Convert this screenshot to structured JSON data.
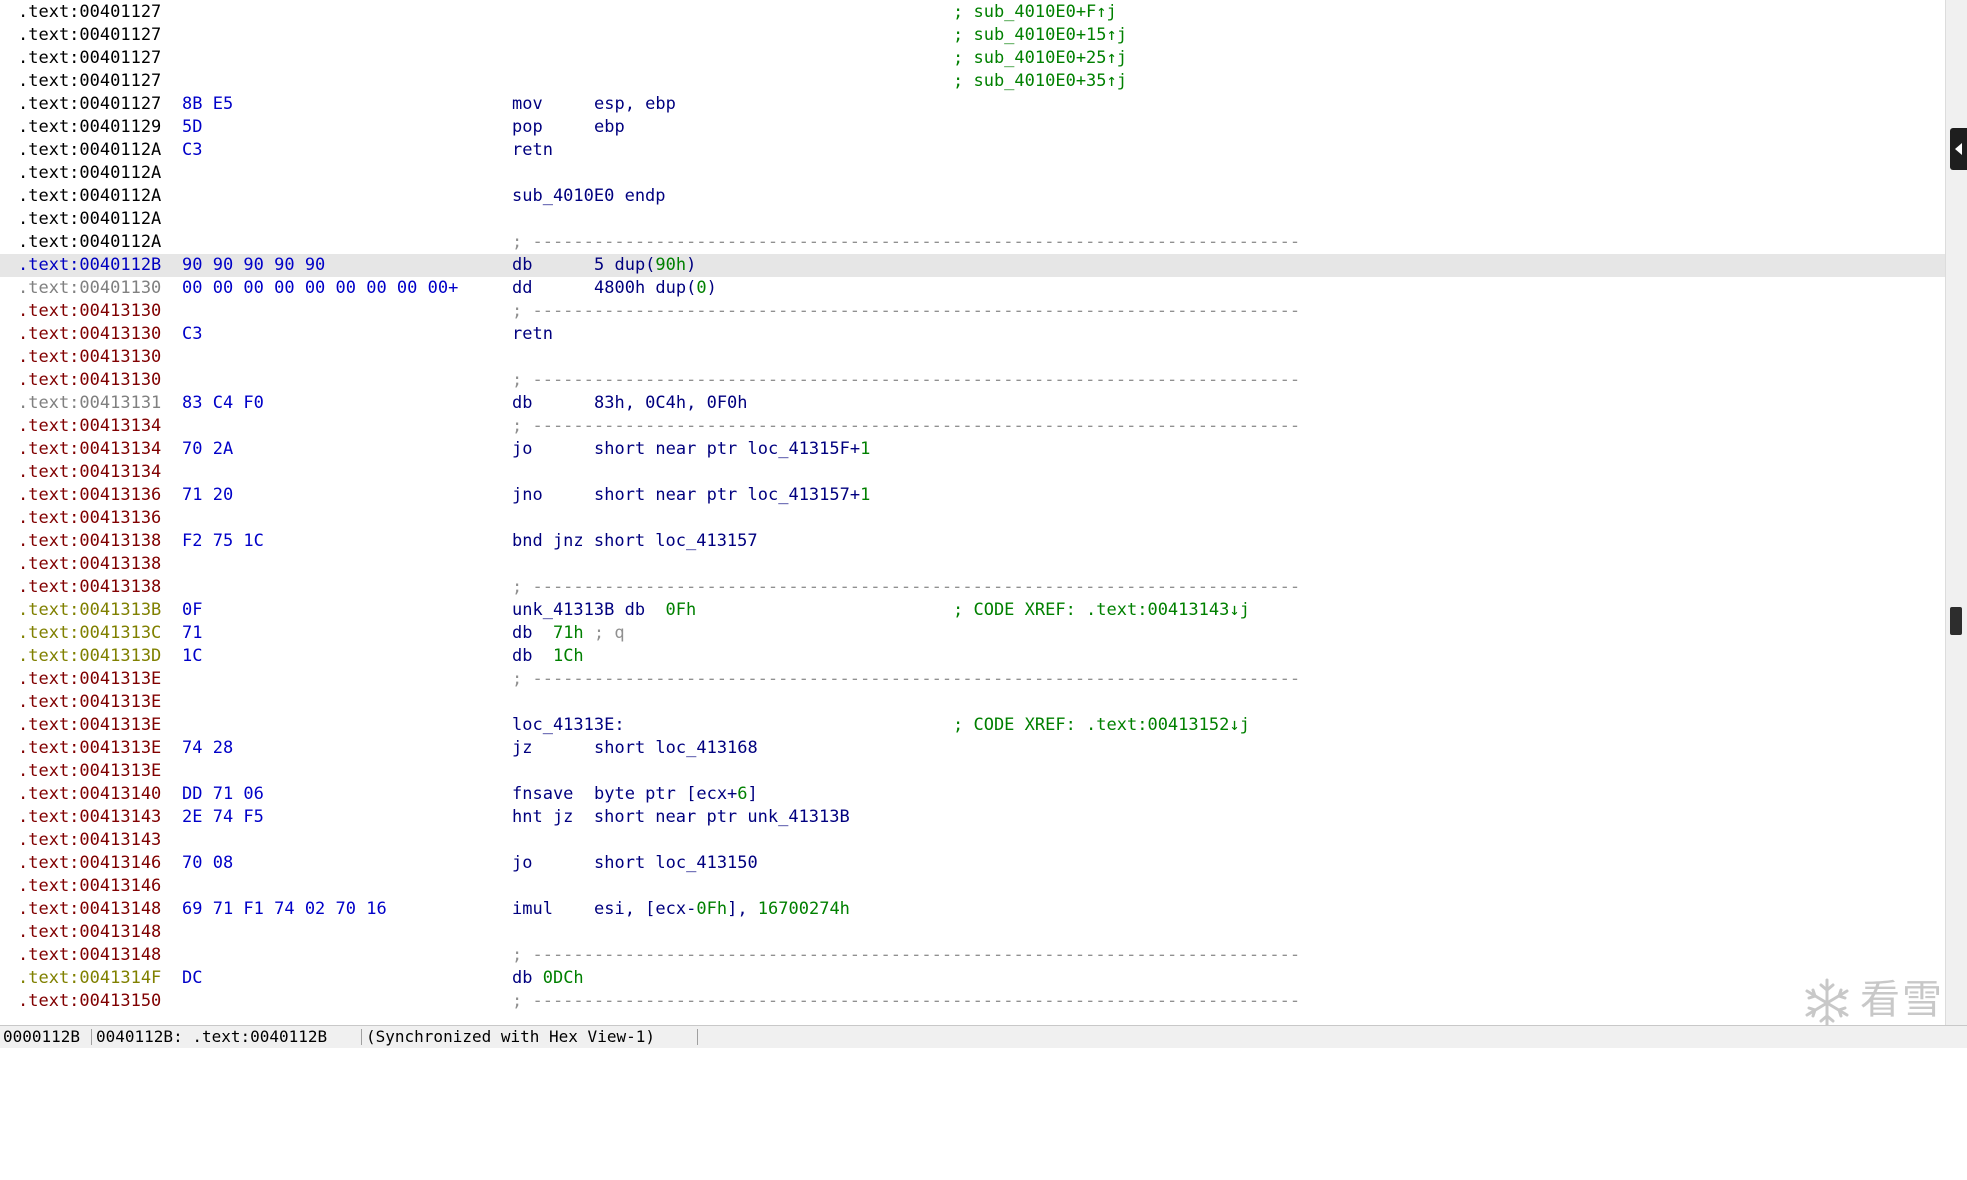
{
  "disassembly": {
    "lines": [
      {
        "addr": ".text:00401127",
        "addr_style": "code",
        "bytes": "",
        "comment": "; sub_4010E0+F↑j"
      },
      {
        "addr": ".text:00401127",
        "addr_style": "code",
        "bytes": "",
        "comment": "; sub_4010E0+15↑j"
      },
      {
        "addr": ".text:00401127",
        "addr_style": "code",
        "bytes": "",
        "comment": "; sub_4010E0+25↑j"
      },
      {
        "addr": ".text:00401127",
        "addr_style": "code",
        "bytes": "",
        "comment": "; sub_4010E0+35↑j"
      },
      {
        "addr": ".text:00401127",
        "addr_style": "code",
        "bytes": "8B E5",
        "mnem": "mov",
        "ops": "esp, ebp"
      },
      {
        "addr": ".text:00401129",
        "addr_style": "code",
        "bytes": "5D",
        "mnem": "pop",
        "ops": "ebp"
      },
      {
        "addr": ".text:0040112A",
        "addr_style": "code",
        "bytes": "C3",
        "mnem": "retn"
      },
      {
        "addr": ".text:0040112A",
        "addr_style": "code",
        "bytes": ""
      },
      {
        "addr": ".text:0040112A",
        "addr_style": "code",
        "bytes": "",
        "text": "sub_4010E0 endp"
      },
      {
        "addr": ".text:0040112A",
        "addr_style": "code",
        "bytes": ""
      },
      {
        "addr": ".text:0040112A",
        "addr_style": "code",
        "bytes": "",
        "sep": "; ---------------------------------------------------------------------------"
      },
      {
        "addr": ".text:0040112B",
        "addr_style": "current",
        "highlight": true,
        "bytes": "90 90 90 90 90",
        "mnem": "db",
        "ops": "5 dup(",
        "num": "90h",
        "ops_tail": ")"
      },
      {
        "addr": ".text:00401130",
        "addr_style": "unexplored",
        "bytes": "00 00 00 00 00 00 00 00 00+",
        "mnem": "dd",
        "ops": "4800h dup(",
        "num": "0",
        "ops_tail": ")"
      },
      {
        "addr": ".text:00413130",
        "addr_style": "red",
        "bytes": "",
        "sep": "; ---------------------------------------------------------------------------"
      },
      {
        "addr": ".text:00413130",
        "addr_style": "red",
        "bytes": "C3",
        "mnem": "retn"
      },
      {
        "addr": ".text:00413130",
        "addr_style": "red",
        "bytes": ""
      },
      {
        "addr": ".text:00413130",
        "addr_style": "red",
        "bytes": "",
        "sep": "; ---------------------------------------------------------------------------"
      },
      {
        "addr": ".text:00413131",
        "addr_style": "unexplored",
        "bytes": "83 C4 F0",
        "mnem": "db",
        "ops": "83h, 0C4h, 0F0h"
      },
      {
        "addr": ".text:00413134",
        "addr_style": "red",
        "bytes": "",
        "sep": "; ---------------------------------------------------------------------------"
      },
      {
        "addr": ".text:00413134",
        "addr_style": "red",
        "bytes": "70 2A",
        "mnem": "jo",
        "ops": "short near ptr loc_41315F+",
        "num": "1"
      },
      {
        "addr": ".text:00413134",
        "addr_style": "red",
        "bytes": ""
      },
      {
        "addr": ".text:00413136",
        "addr_style": "red",
        "bytes": "71 20",
        "mnem": "jno",
        "ops": "short near ptr loc_413157+",
        "num": "1"
      },
      {
        "addr": ".text:00413136",
        "addr_style": "red",
        "bytes": ""
      },
      {
        "addr": ".text:00413138",
        "addr_style": "red",
        "bytes": "F2 75 1C",
        "text": "bnd jnz short loc_413157"
      },
      {
        "addr": ".text:00413138",
        "addr_style": "red",
        "bytes": ""
      },
      {
        "addr": ".text:00413138",
        "addr_style": "red",
        "bytes": "",
        "sep": "; ---------------------------------------------------------------------------"
      },
      {
        "addr": ".text:0041313B",
        "addr_style": "olive",
        "bytes": "0F",
        "text": "unk_41313B db  ",
        "num": "0Fh",
        "comment": "; CODE XREF: .text:00413143↓j"
      },
      {
        "addr": ".text:0041313C",
        "addr_style": "olive",
        "bytes": "71",
        "text": "db  ",
        "num": "71h",
        "cmt": " ; q"
      },
      {
        "addr": ".text:0041313D",
        "addr_style": "olive",
        "bytes": "1C",
        "text": "db  ",
        "num": "1Ch"
      },
      {
        "addr": ".text:0041313E",
        "addr_style": "red",
        "bytes": "",
        "sep": "; ---------------------------------------------------------------------------"
      },
      {
        "addr": ".text:0041313E",
        "addr_style": "red",
        "bytes": ""
      },
      {
        "addr": ".text:0041313E",
        "addr_style": "red",
        "bytes": "",
        "text": "loc_41313E:",
        "comment": "; CODE XREF: .text:00413152↓j"
      },
      {
        "addr": ".text:0041313E",
        "addr_style": "red",
        "bytes": "74 28",
        "mnem": "jz",
        "ops": "short loc_413168"
      },
      {
        "addr": ".text:0041313E",
        "addr_style": "red",
        "bytes": ""
      },
      {
        "addr": ".text:00413140",
        "addr_style": "red",
        "bytes": "DD 71 06",
        "mnem": "fnsave",
        "ops": "byte ptr [ecx+",
        "num": "6",
        "ops_tail": "]"
      },
      {
        "addr": ".text:00413143",
        "addr_style": "red",
        "bytes": "2E 74 F5",
        "text": "hnt jz  short near ptr unk_41313B"
      },
      {
        "addr": ".text:00413143",
        "addr_style": "red",
        "bytes": ""
      },
      {
        "addr": ".text:00413146",
        "addr_style": "red",
        "bytes": "70 08",
        "mnem": "jo",
        "ops": "short loc_413150"
      },
      {
        "addr": ".text:00413146",
        "addr_style": "red",
        "bytes": ""
      },
      {
        "addr": ".text:00413148",
        "addr_style": "red",
        "bytes": "69 71 F1 74 02 70 16",
        "mnem": "imul",
        "ops": "esi, [ecx-",
        "num": "0Fh",
        "ops_tail": "], ",
        "num2": "16700274h"
      },
      {
        "addr": ".text:00413148",
        "addr_style": "red",
        "bytes": ""
      },
      {
        "addr": ".text:00413148",
        "addr_style": "red",
        "bytes": "",
        "sep": "; ---------------------------------------------------------------------------"
      },
      {
        "addr": ".text:0041314F",
        "addr_style": "olive",
        "bytes": "DC",
        "text": "db ",
        "num": "0DCh"
      },
      {
        "addr": ".text:00413150",
        "addr_style": "red",
        "bytes": "",
        "sep": "; ---------------------------------------------------------------------------"
      }
    ]
  },
  "status_bar": {
    "offset": "0000112B",
    "location": "0040112B: .text:0040112B",
    "sync": "(Synchronized with Hex View-1)"
  },
  "watermark": {
    "text": "看雪"
  },
  "colors": {
    "code_address": "#000000",
    "current_address": "#0000c0",
    "unexplored_address": "#808080",
    "unreached_address": "#800000",
    "data_address": "#808000",
    "opcode_bytes": "#0000c8",
    "instruction": "#00007f",
    "numeric": "#008000",
    "comment": "#008000",
    "highlight_row": "#e6e6e6"
  },
  "icons": [
    "collapse-panel-icon",
    "snowflake-logo-icon"
  ]
}
